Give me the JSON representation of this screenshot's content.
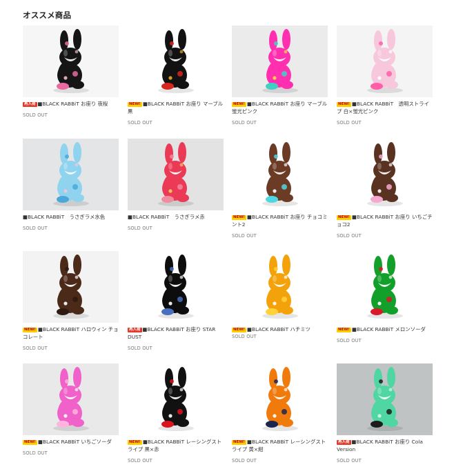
{
  "section": {
    "title": "オススメ商品"
  },
  "products": [
    {
      "badge": "再入荷",
      "badge_type": "restock",
      "name": "■BLACK RABBiT お座り 夜桜",
      "status": "SOLD OUT",
      "bg": "#f6f6f6",
      "body": "#151515",
      "accent": "#e86aa0",
      "accent2": "#f2b9c9"
    },
    {
      "badge": "NEW!",
      "badge_type": "new",
      "name": "■BLACK RABBiT お座り マーブル黒",
      "status": "SOLD OUT",
      "bg": "#ffffff",
      "body": "#121212",
      "accent": "#d7261e",
      "accent2": "#f1a81b"
    },
    {
      "badge": "NEW!",
      "badge_type": "new",
      "name": "■BLACK RABBiT お座り マーブル蛍光ピンク",
      "status": "SOLD OUT",
      "bg": "#ebebeb",
      "body": "#ff2fb0",
      "accent": "#3fd0c4",
      "accent2": "#f7e33a"
    },
    {
      "badge": "NEW!",
      "badge_type": "new",
      "name": "■BLACK RABBiT　透明ストライプ 白×蛍光ピンク",
      "status": "SOLD OUT",
      "bg": "#f4f4f4",
      "body": "#f7c8dc",
      "accent": "#ff5ea8",
      "accent2": "#ffffff"
    },
    {
      "badge": "",
      "badge_type": "",
      "name": "■BLACK RABBiT　うさぎラメ水色",
      "status": "SOLD OUT",
      "bg": "#e3e5e6",
      "body": "#8fd3ef",
      "accent": "#4aa8d8",
      "accent2": "#f2c6d8"
    },
    {
      "badge": "",
      "badge_type": "",
      "name": "■BLACK RABBiT　うさぎラメ赤",
      "status": "SOLD OUT",
      "bg": "#e3e3e3",
      "body": "#ea3a55",
      "accent": "#f28aa0",
      "accent2": "#f7d15e"
    },
    {
      "badge": "NEW!",
      "badge_type": "new",
      "name": "■BLACK RABBiT お座り チョコミント2",
      "status": "SOLD OUT",
      "bg": "#ffffff",
      "body": "#6b3b25",
      "accent": "#4fd6e3",
      "accent2": "#ffffff"
    },
    {
      "badge": "NEW!",
      "badge_type": "new",
      "name": "■BLACK RABBiT お座り いちごチョコ2",
      "status": "SOLD OUT",
      "bg": "#ffffff",
      "body": "#5a3222",
      "accent": "#f6a8cf",
      "accent2": "#ffffff"
    },
    {
      "badge": "NEW!",
      "badge_type": "new",
      "name": "■BLACK RABBiT ハロウィン チョコレート",
      "status": "SOLD OUT",
      "bg": "#f3f3f3",
      "body": "#4b2a1a",
      "accent": "#2e1a10",
      "accent2": "#ffffff"
    },
    {
      "badge": "再入荷",
      "badge_type": "restock",
      "name": "■BLACK RABBiT お座り STAR DUST",
      "status": "SOLD OUT",
      "bg": "#ffffff",
      "body": "#0d0d0d",
      "accent": "#4a6fbf",
      "accent2": "#ffffff"
    },
    {
      "badge": "NEW!",
      "badge_type": "new",
      "name": "■BLACK RABBiT ハチミツ",
      "status": "SOLD OUT",
      "bg": "#ffffff",
      "body": "#f4a20c",
      "accent": "#ffd23a",
      "accent2": "#ffffff"
    },
    {
      "badge": "NEW!",
      "badge_type": "new",
      "name": "■BLACK RABBiT メロンソーダ",
      "status": "SOLD OUT",
      "bg": "#ffffff",
      "body": "#13a02a",
      "accent": "#d8192a",
      "accent2": "#ffffff"
    },
    {
      "badge": "NEW!",
      "badge_type": "new",
      "name": "■BLACK RABBiT いちごソーダ",
      "status": "SOLD OUT",
      "bg": "#e9e9e9",
      "body": "#f062c9",
      "accent": "#ffb3dd",
      "accent2": "#ffffff"
    },
    {
      "badge": "NEW!",
      "badge_type": "new",
      "name": "■BLACK RABBiT レーシングストライプ 黒×赤",
      "status": "SOLD OUT",
      "bg": "#ffffff",
      "body": "#111111",
      "accent": "#d8151e",
      "accent2": "#ffffff"
    },
    {
      "badge": "NEW!",
      "badge_type": "new",
      "name": "■BLACK RABBiT レーシングストライプ 黄×紺",
      "status": "SOLD OUT",
      "bg": "#ffffff",
      "body": "#f07a0c",
      "accent": "#1c2450",
      "accent2": "#ffffff"
    },
    {
      "badge": "再入荷",
      "badge_type": "restock",
      "name": "■BLACK RABBiT お座り Cola Version",
      "status": "SOLD OUT",
      "bg": "#bfc3c4",
      "body": "#4fd6a3",
      "accent": "#1c1c1c",
      "accent2": "#d8f5ea"
    }
  ]
}
